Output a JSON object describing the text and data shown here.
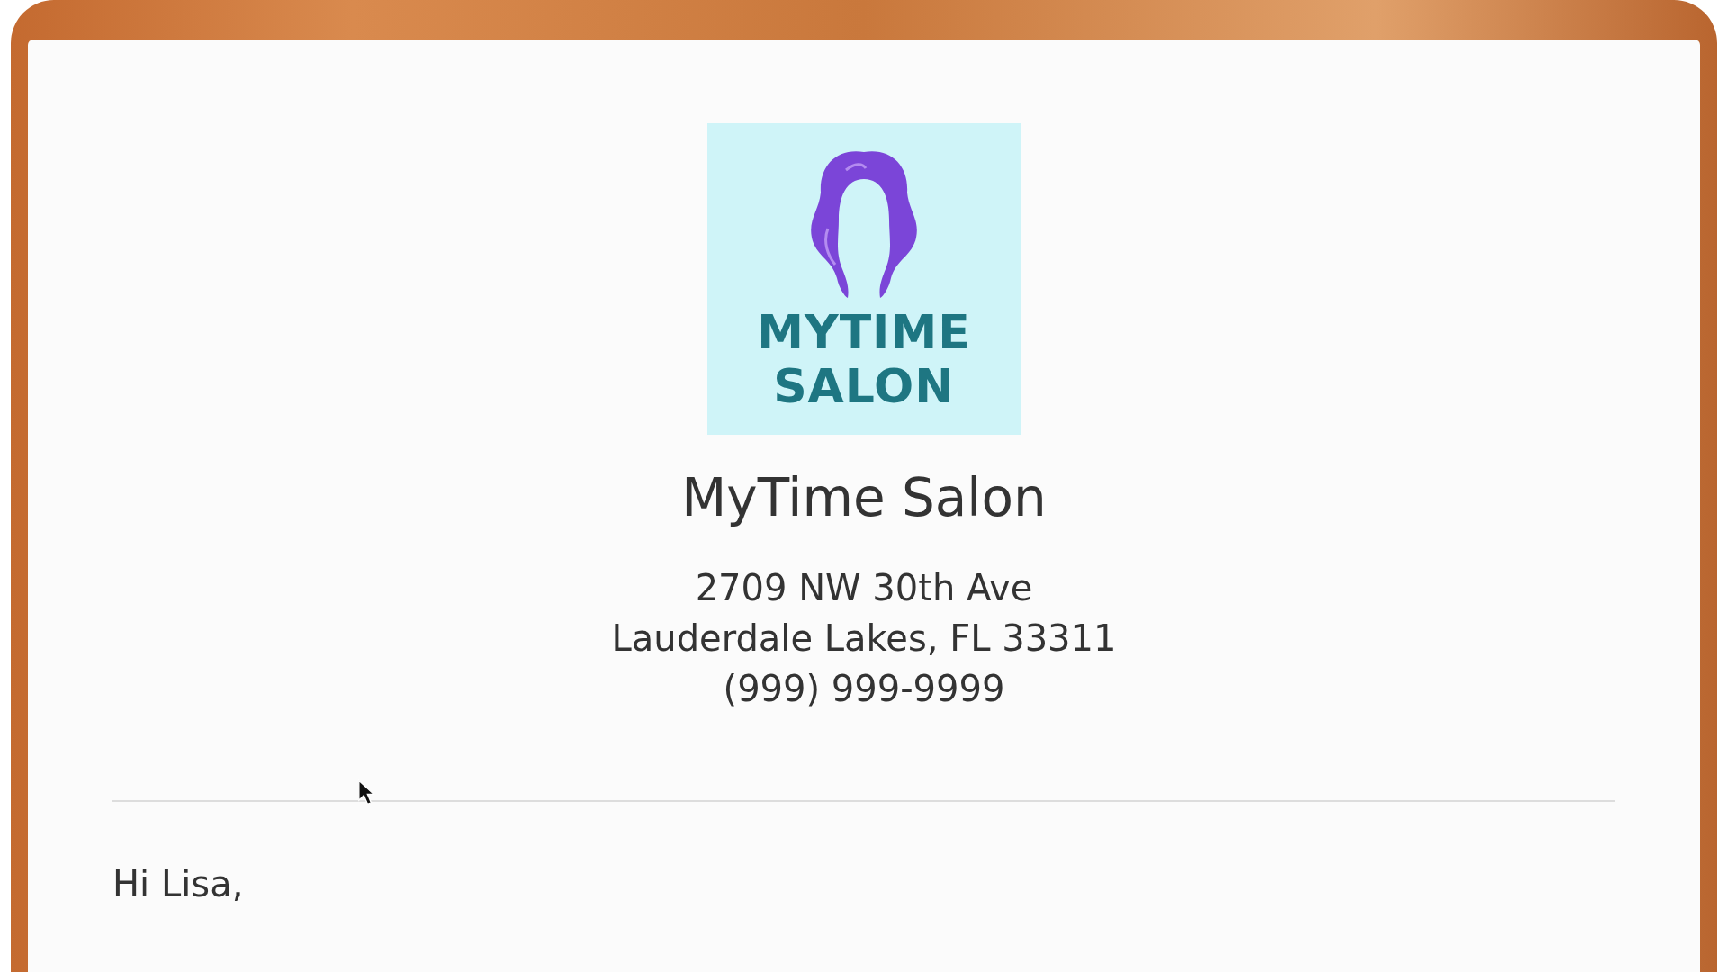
{
  "logo": {
    "lines": [
      "MYTIME",
      "SALON"
    ]
  },
  "business": {
    "name": "MyTime Salon",
    "address_lines": [
      "2709 NW 30th Ave",
      "Lauderdale Lakes, FL 33311"
    ],
    "phone": "(999) 999-9999"
  },
  "greeting": "Hi Lisa,"
}
